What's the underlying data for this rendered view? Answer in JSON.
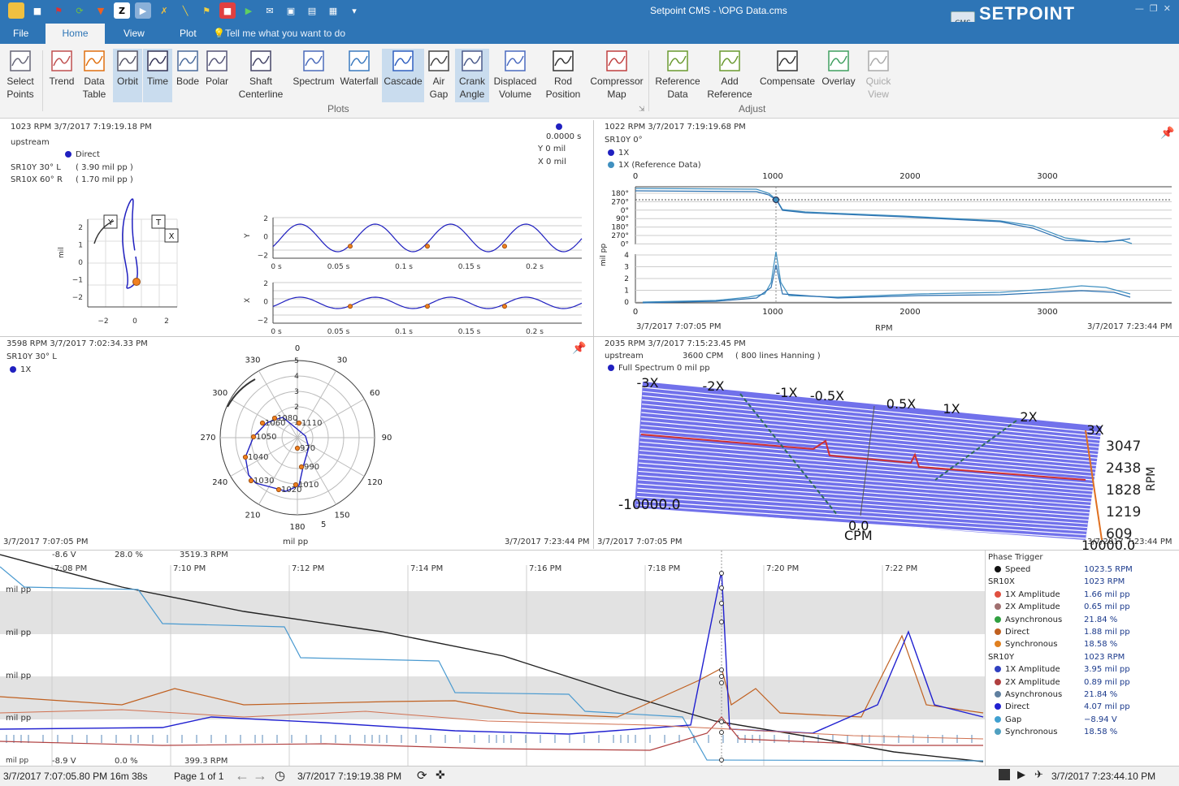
{
  "titlebar": {
    "title": "Setpoint CMS  -  \\OPG Data.cms",
    "brand": "SETPOINT",
    "badge": "CMS"
  },
  "tabs": [
    {
      "label": "File"
    },
    {
      "label": "Home"
    },
    {
      "label": "View"
    },
    {
      "label": "Plot"
    }
  ],
  "tellme": "Tell me what you want to do",
  "ribbon": {
    "buttons": [
      "Select\nPoints",
      "Trend",
      "Data\nTable",
      "Orbit",
      "Time",
      "Bode",
      "Polar",
      "Shaft\nCenterline",
      "Spectrum",
      "Waterfall",
      "Cascade",
      "Air\nGap",
      "Crank\nAngle",
      "Displaced\nVolume",
      "Rod\nPosition",
      "Compressor\nMap",
      "Reference\nData",
      "Add\nReference",
      "Compensate",
      "Overlay",
      "Quick\nView"
    ],
    "group_plots": "Plots",
    "group_adjust": "Adjust"
  },
  "orbit_panel": {
    "header": "1023 RPM   3/7/2017 7:19:19.18 PM",
    "location": "upstream",
    "legend": "Direct",
    "ch1": "SR10Y  30° L",
    "ch1_val": "( 3.90 mil pp )",
    "ch2": "SR10X  60° R",
    "ch2_val": "( 1.70 mil pp )",
    "cursor_val": "0.0000 s",
    "y_readout": "Y  0   mil",
    "x_readout": "X  0   mil",
    "orbit_ylabel": "mil",
    "orbit_yticks": [
      "2",
      "1",
      "0",
      "−1",
      "−2"
    ],
    "orbit_xticks": [
      "−2",
      "0",
      "2"
    ],
    "box_y": "Y",
    "box_t": "T",
    "box_x": "X",
    "time_ticks": [
      "0 s",
      "0.05 s",
      "0.1 s",
      "0.15 s",
      "0.2 s"
    ],
    "time_y_label": "Y",
    "time_x_label": "X",
    "time_yticks": [
      "2",
      "0",
      "−2"
    ]
  },
  "bode_panel": {
    "header": "1022 RPM   3/7/2017 7:19:19.68 PM",
    "channel": "SR10Y 0°",
    "legend1": "1X",
    "legend2": "1X (Reference Data)",
    "xticks": [
      "0",
      "1000",
      "2000",
      "3000"
    ],
    "phase_ticks": [
      "180°",
      "270°",
      "0°",
      "90°",
      "180°",
      "270°",
      "0°"
    ],
    "amp_ticks": [
      "4",
      "3",
      "2",
      "1",
      "0"
    ],
    "ylabel": "mil pp",
    "xlabel": "RPM",
    "start": "3/7/2017 7:07:05 PM",
    "end": "3/7/2017 7:23:44 PM"
  },
  "polar_panel": {
    "header": "3598 RPM    3/7/2017 7:02:34.33 PM",
    "channel": "SR10Y 30° L",
    "legend": "1X",
    "angles": [
      "30",
      "60",
      "90",
      "120",
      "150",
      "180",
      "210",
      "240",
      "270",
      "300",
      "330",
      "0"
    ],
    "radii": [
      "5",
      "4",
      "3",
      "2",
      "1"
    ],
    "bottom_r": "5",
    "points": [
      "1080",
      "1060",
      "1110",
      "1050",
      "970",
      "1040",
      "990",
      "1030",
      "1020",
      "1010"
    ],
    "unit": "mil  pp",
    "start": "3/7/2017 7:07:05 PM",
    "end": "3/7/2017 7:23:44 PM"
  },
  "cascade_panel": {
    "header": "2035 RPM   3/7/2017 7:15:23.45 PM",
    "location": "upstream",
    "cpm": "3600 CPM",
    "lines": "( 800 lines   Hanning )",
    "legend": "Full Spectrum  0 mil pp",
    "orders": [
      "-3X",
      "-2X",
      "-1X",
      "-0.5X",
      "0.5X",
      "1X",
      "2X",
      "3X"
    ],
    "rpm_ticks": [
      "3047",
      "2438",
      "1828",
      "1219",
      "609"
    ],
    "rpm_label": "RPM",
    "left_val": "-10000.0",
    "zero": "0.0",
    "cpm_label": "CPM",
    "right_val": "10000.0",
    "start": "3/7/2017 7:07:05 PM",
    "end": "3/7/2017 7:23:44 PM"
  },
  "trend_panel": {
    "top_vals": [
      "-8.6  V",
      "28.0  %",
      "3519.3  RPM"
    ],
    "bottom_vals": [
      "-8.9  V",
      "0.0  %",
      "399.3  RPM"
    ],
    "time_ticks": [
      "7:08 PM",
      "7:10 PM",
      "7:12 PM",
      "7:14 PM",
      "7:16 PM",
      "7:18 PM",
      "7:20 PM",
      "7:22 PM"
    ],
    "unit_labels": [
      "mil pp",
      "mil pp",
      "mil pp",
      "mil pp",
      "mil pp"
    ]
  },
  "legend": {
    "title": "Phase Trigger",
    "rows": [
      {
        "name": "Speed",
        "value": "1023.5 RPM",
        "color": "#111111",
        "indent": true
      },
      {
        "name": "SR10X",
        "value": "1023 RPM",
        "color": "",
        "indent": false
      },
      {
        "name": "1X Amplitude",
        "value": "1.66 mil pp",
        "color": "#e05040",
        "indent": true
      },
      {
        "name": "2X Amplitude",
        "value": "0.65 mil pp",
        "color": "#a07070",
        "indent": true
      },
      {
        "name": "Asynchronous",
        "value": "21.84 %",
        "color": "#30a040",
        "indent": true
      },
      {
        "name": "Direct",
        "value": "1.88 mil pp",
        "color": "#c06020",
        "indent": true
      },
      {
        "name": "Synchronous",
        "value": "18.58 %",
        "color": "#e08020",
        "indent": true
      },
      {
        "name": "SR10Y",
        "value": "1023 RPM",
        "color": "",
        "indent": false
      },
      {
        "name": "1X Amplitude",
        "value": "3.95 mil pp",
        "color": "#3040c0",
        "indent": true
      },
      {
        "name": "2X Amplitude",
        "value": "0.89 mil pp",
        "color": "#b04040",
        "indent": true
      },
      {
        "name": "Asynchronous",
        "value": "21.84 %",
        "color": "#6080a0",
        "indent": true
      },
      {
        "name": "Direct",
        "value": "4.07 mil pp",
        "color": "#2020d0",
        "indent": true
      },
      {
        "name": "Gap",
        "value": "−8.94 V",
        "color": "#40a0d0",
        "indent": true
      },
      {
        "name": "Synchronous",
        "value": "18.58 %",
        "color": "#50a0c0",
        "indent": true
      }
    ]
  },
  "statusbar": {
    "start": "3/7/2017 7:07:05.80 PM  16m 38s",
    "page": "Page 1 of 1",
    "cursor": "3/7/2017 7:19:19.38 PM",
    "end": "3/7/2017 7:23:44.10 PM"
  }
}
